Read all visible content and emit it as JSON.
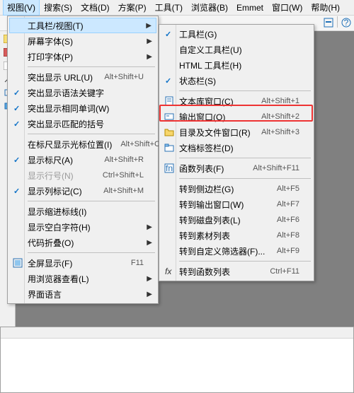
{
  "menubar": {
    "items": [
      {
        "label": "视图(V)",
        "open": true
      },
      {
        "label": "搜索(S)"
      },
      {
        "label": "文档(D)"
      },
      {
        "label": "方案(P)"
      },
      {
        "label": "工具(T)"
      },
      {
        "label": "浏览器(B)"
      },
      {
        "label": "Emmet"
      },
      {
        "label": "窗口(W)"
      },
      {
        "label": "帮助(H)"
      }
    ]
  },
  "dd1": {
    "groups": [
      [
        {
          "label": "工具栏/视图(T)",
          "sub": true,
          "hl": true
        },
        {
          "label": "屏幕字体(S)",
          "sub": true
        },
        {
          "label": "打印字体(P)",
          "sub": true
        }
      ],
      [
        {
          "label": "突出显示 URL(U)",
          "shortcut": "Alt+Shift+U"
        },
        {
          "label": "突出显示语法关键字",
          "check": true
        },
        {
          "label": "突出显示相同单词(W)",
          "check": true
        },
        {
          "label": "突出显示匹配的括号",
          "check": true
        }
      ],
      [
        {
          "label": "在标尺显示光标位置(I)",
          "shortcut": "Alt+Shift+C"
        },
        {
          "label": "显示标尺(A)",
          "shortcut": "Alt+Shift+R",
          "check": true
        },
        {
          "label": "显示行号(N)",
          "shortcut": "Ctrl+Shift+L",
          "disabled": true
        },
        {
          "label": "显示列标记(C)",
          "shortcut": "Alt+Shift+M",
          "check": true
        }
      ],
      [
        {
          "label": "显示缩进标线(I)"
        },
        {
          "label": "显示空白字符(H)",
          "sub": true
        },
        {
          "label": "代码折叠(O)",
          "sub": true
        }
      ],
      [
        {
          "label": "全屏显示(F)",
          "shortcut": "F11",
          "icon": "fullscreen"
        },
        {
          "label": "用浏览器查看(L)",
          "sub": true
        },
        {
          "label": "界面语言",
          "sub": true
        }
      ]
    ]
  },
  "dd2": {
    "groups": [
      [
        {
          "label": "工具栏(G)",
          "check": true
        },
        {
          "label": "自定义工具栏(U)"
        },
        {
          "label": "HTML 工具栏(H)"
        },
        {
          "label": "状态栏(S)",
          "check": true
        }
      ],
      [
        {
          "label": "文本库窗口(C)",
          "shortcut": "Alt+Shift+1",
          "icon": "textlib"
        },
        {
          "label": "输出窗口(O)",
          "shortcut": "Alt+Shift+2",
          "icon": "output"
        },
        {
          "label": "目录及文件窗口(R)",
          "shortcut": "Alt+Shift+3",
          "icon": "folder",
          "highlightTarget": true
        },
        {
          "label": "文档标签栏(D)",
          "icon": "tabs"
        }
      ],
      [
        {
          "label": "函数列表(F)",
          "shortcut": "Alt+Shift+F11",
          "icon": "func"
        }
      ],
      [
        {
          "label": "转到侧边栏(G)",
          "shortcut": "Alt+F5"
        },
        {
          "label": "转到输出窗口(W)",
          "shortcut": "Alt+F7"
        },
        {
          "label": "转到磁盘列表(L)",
          "shortcut": "Alt+F6"
        },
        {
          "label": "转到素材列表",
          "shortcut": "Alt+F8"
        },
        {
          "label": "转到自定义筛选器(F)...",
          "shortcut": "Alt+F9"
        }
      ],
      [
        {
          "label": "转到函数列表",
          "shortcut": "Ctrl+F11",
          "icon": "fx"
        }
      ]
    ]
  }
}
